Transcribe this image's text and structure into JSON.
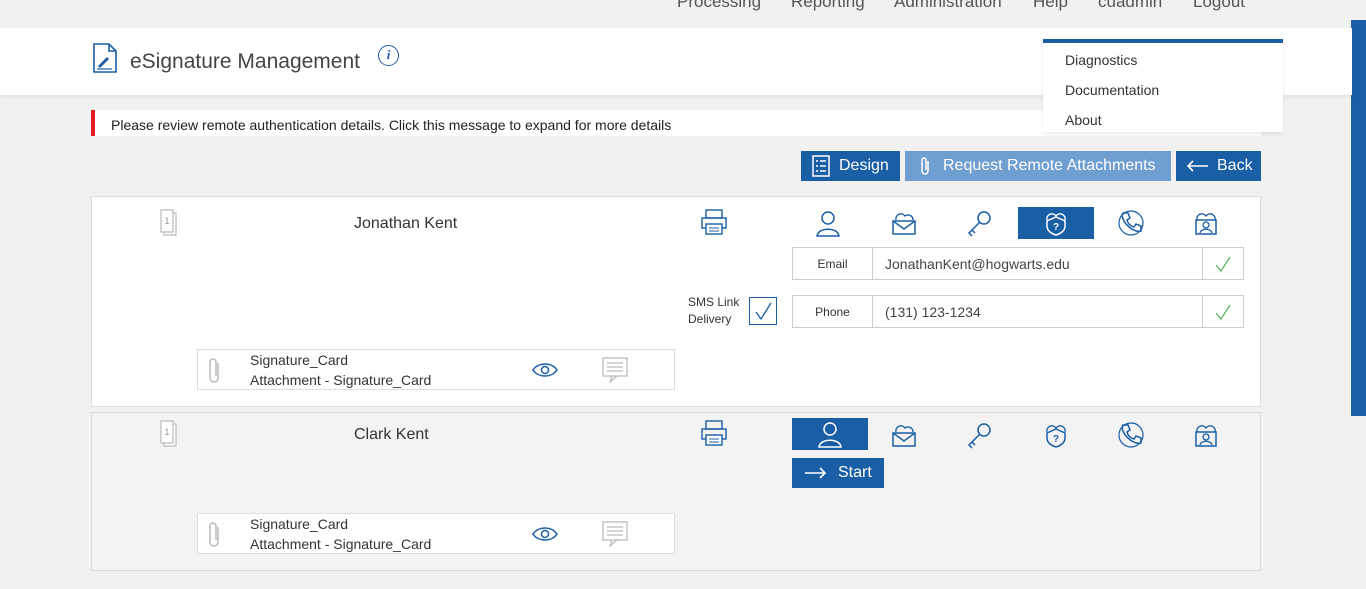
{
  "topnav": {
    "items": [
      "Processing",
      "Reporting",
      "Administration",
      "Help",
      "cuadmin",
      "Logout"
    ]
  },
  "header": {
    "title": "eSignature Management",
    "info_label": "i"
  },
  "help_menu": {
    "items": [
      "Diagnostics",
      "Documentation",
      "About"
    ]
  },
  "alert": {
    "message": "Please review remote authentication details. Click this message to expand for more details"
  },
  "actions": {
    "design": "Design",
    "request_attachments": "Request Remote Attachments",
    "back": "Back"
  },
  "signers": [
    {
      "page": "1",
      "name": "Jonathan Kent",
      "auth_methods": [
        "user-icon",
        "envelope-cloud-icon",
        "key-icon",
        "shield-question-icon",
        "phone-icon",
        "id-cloud-icon"
      ],
      "active_method": "shield-question-icon",
      "email_label": "Email",
      "email": "JonathanKent@hogwarts.edu",
      "phone_label": "Phone",
      "phone": "(131) 123-1234",
      "sms_label_1": "SMS Link",
      "sms_label_2": "Delivery",
      "sms_checked": true,
      "attachment_name": "Signature_Card",
      "attachment_desc": "Attachment - Signature_Card"
    },
    {
      "page": "1",
      "name": "Clark Kent",
      "auth_methods": [
        "user-icon",
        "envelope-cloud-icon",
        "key-icon",
        "shield-question-icon",
        "phone-icon",
        "id-cloud-icon"
      ],
      "active_method": "user-icon",
      "start_label": "Start",
      "attachment_name": "Signature_Card",
      "attachment_desc": "Attachment - Signature_Card"
    }
  ],
  "colors": {
    "accent": "#1a5ea6",
    "alert": "#e31b23",
    "ok": "#5cb85c"
  }
}
